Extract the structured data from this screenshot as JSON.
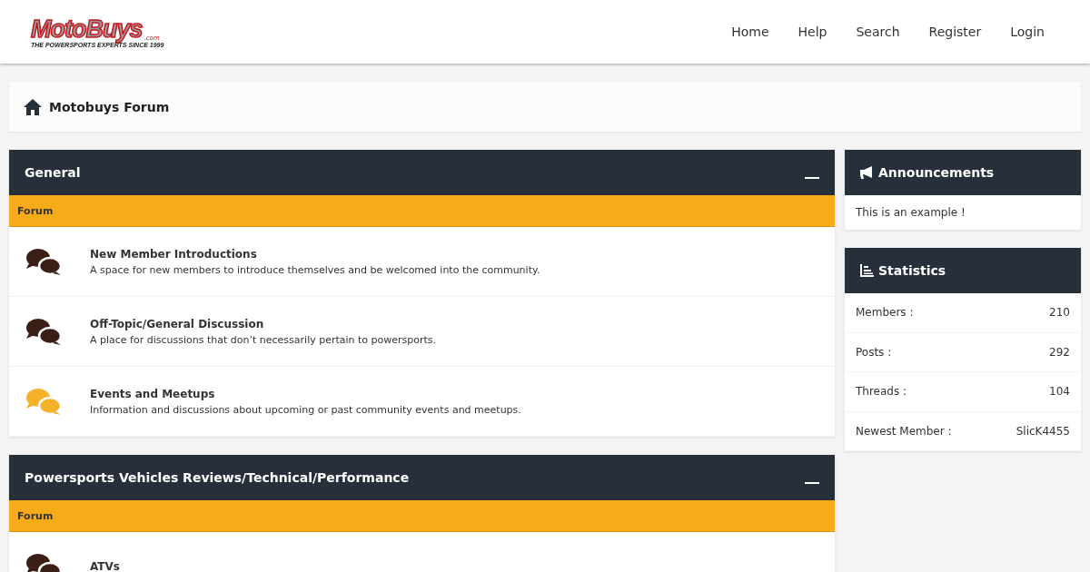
{
  "logo": {
    "name": "MotoBuys",
    "suffix": ".com",
    "tagline": "THE POWERSPORTS EXPERTS SINCE 1999"
  },
  "nav": [
    "Home",
    "Help",
    "Search",
    "Register",
    "Login"
  ],
  "breadcrumb": "Motobuys Forum",
  "categories": [
    {
      "title": "General",
      "column": "Forum",
      "forums": [
        {
          "name": "New Member Introductions",
          "description": "A space for new members to introduce themselves and be welcomed into the community.",
          "color": "#3b1f16"
        },
        {
          "name": "Off-Topic/General Discussion",
          "description": "A place for discussions that don’t necessarily pertain to powersports.",
          "color": "#3b1f16"
        },
        {
          "name": "Events and Meetups",
          "description": "Information and discussions about upcoming or past community events and meetups.",
          "color": "#f6b12a"
        }
      ]
    },
    {
      "title": "Powersports Vehicles Reviews/Technical/Performance",
      "column": "Forum",
      "forums": [
        {
          "name": "ATVs",
          "color": "#3b1f16"
        }
      ]
    }
  ],
  "announcements": {
    "title": "Announcements",
    "text": "This is an example !"
  },
  "statistics": {
    "title": "Statistics",
    "rows": [
      {
        "label": "Members :",
        "value": "210"
      },
      {
        "label": "Posts :",
        "value": "292"
      },
      {
        "label": "Threads :",
        "value": "104"
      },
      {
        "label": "Newest Member :",
        "value": "SlicK4455"
      }
    ]
  }
}
